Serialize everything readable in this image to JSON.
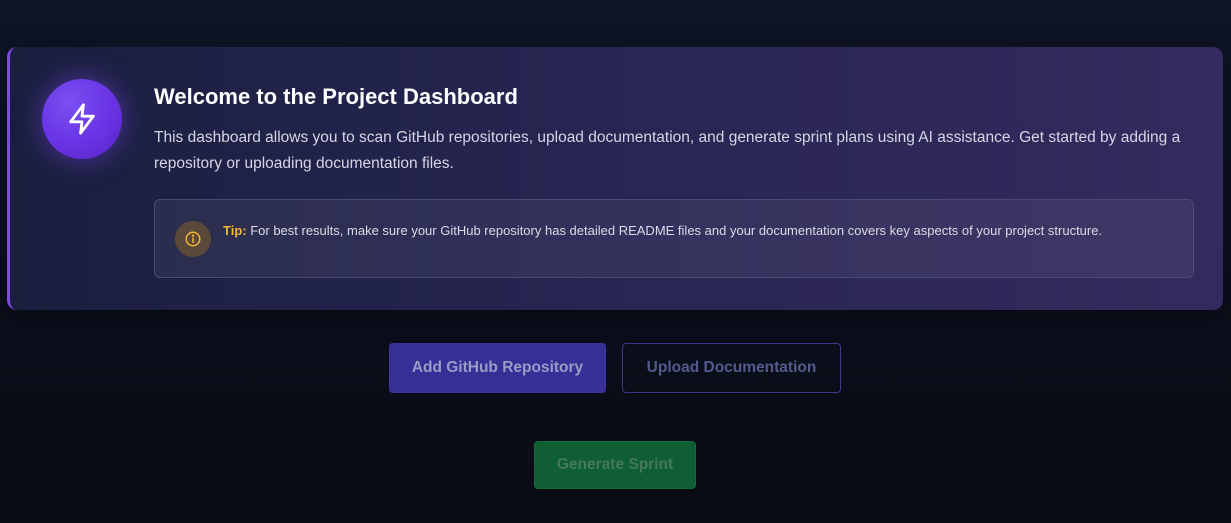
{
  "welcome": {
    "title": "Welcome to the Project Dashboard",
    "description": "This dashboard allows you to scan GitHub repositories, upload documentation, and generate sprint plans using AI assistance. Get started by adding a repository or uploading documentation files.",
    "icon": "lightning-bolt-icon"
  },
  "tip": {
    "label": "Tip:",
    "text": " For best results, make sure your GitHub repository has detailed README files and your documentation covers key aspects of your project structure.",
    "icon": "info-icon"
  },
  "actions": {
    "add_repo_label": "Add GitHub Repository",
    "upload_docs_label": "Upload Documentation",
    "generate_sprint_label": "Generate Sprint"
  },
  "colors": {
    "accent_purple": "#6a35e6",
    "tip_label": "#f2b632",
    "primary_button": "#372f95",
    "sprint_button": "#0f5e34"
  }
}
